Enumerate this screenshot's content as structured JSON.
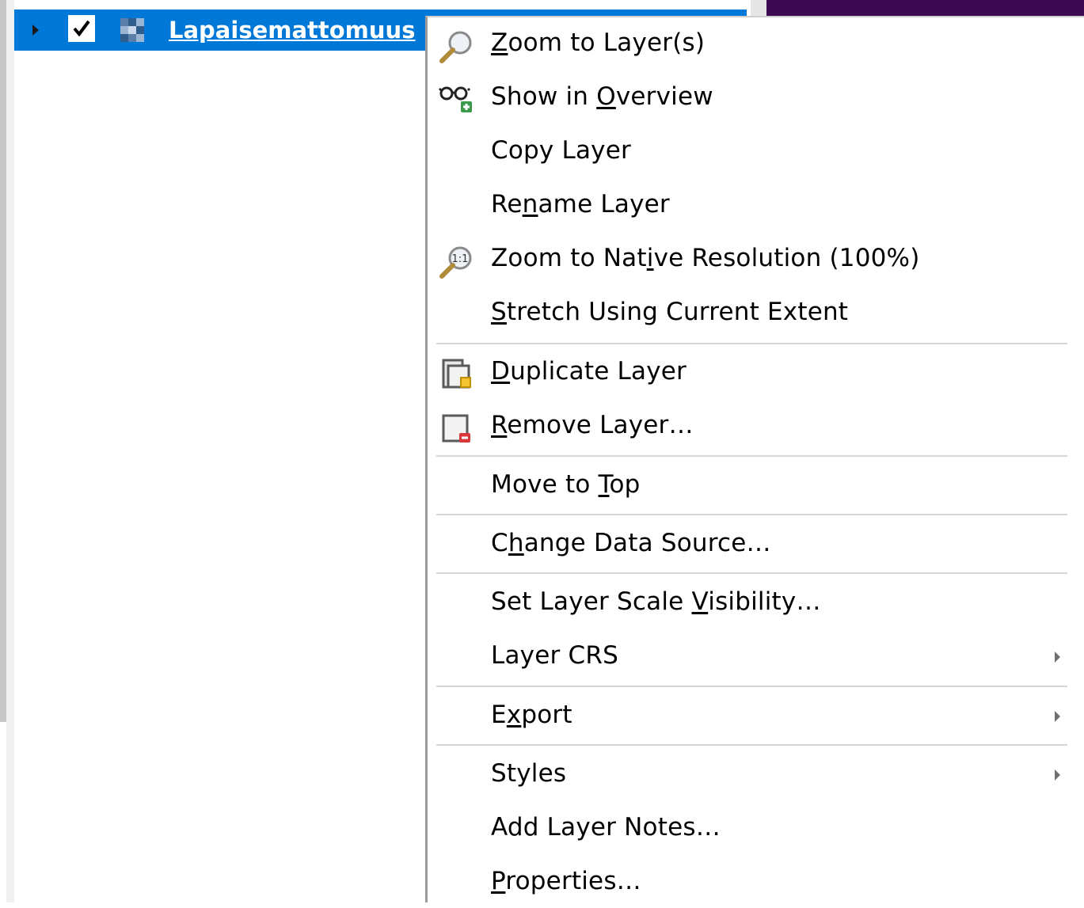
{
  "layer_panel": {
    "layer_name": "Lapaisemattomuus",
    "checkbox_checked": true,
    "selected": true
  },
  "context_menu": {
    "items": [
      {
        "id": "zoom-to-layers",
        "pre": "",
        "key": "Z",
        "post": "oom to Layer(s)",
        "icon": "zoom-layer-icon"
      },
      {
        "id": "show-in-overview",
        "pre": "Show in ",
        "key": "O",
        "post": "verview",
        "icon": "overview-glasses-icon"
      },
      {
        "id": "copy-layer",
        "pre": "Copy Layer",
        "key": "",
        "post": "",
        "icon": ""
      },
      {
        "id": "rename-layer",
        "pre": "Re",
        "key": "n",
        "post": "ame Layer",
        "icon": ""
      },
      {
        "id": "zoom-native",
        "pre": "Zoom to Nat",
        "key": "i",
        "post": "ve Resolution (100%)",
        "icon": "zoom-native-icon"
      },
      {
        "id": "stretch-extent",
        "pre": "",
        "key": "S",
        "post": "tretch Using Current Extent",
        "icon": ""
      },
      {
        "id": "duplicate-layer",
        "pre": "",
        "key": "D",
        "post": "uplicate Layer",
        "icon": "duplicate-layer-icon"
      },
      {
        "id": "remove-layer",
        "pre": "",
        "key": "R",
        "post": "emove Layer…",
        "icon": "remove-layer-icon"
      },
      {
        "id": "move-to-top",
        "pre": "Move to ",
        "key": "T",
        "post": "op",
        "icon": ""
      },
      {
        "id": "change-data-source",
        "pre": "C",
        "key": "h",
        "post": "ange Data Source…",
        "icon": ""
      },
      {
        "id": "scale-visibility",
        "pre": "Set Layer Scale ",
        "key": "V",
        "post": "isibility…",
        "icon": ""
      },
      {
        "id": "layer-crs",
        "pre": "Layer CRS",
        "key": "",
        "post": "",
        "icon": "",
        "submenu": true
      },
      {
        "id": "export",
        "pre": "E",
        "key": "x",
        "post": "port",
        "icon": "",
        "submenu": true
      },
      {
        "id": "styles",
        "pre": "Styles",
        "key": "",
        "post": "",
        "icon": "",
        "submenu": true
      },
      {
        "id": "add-layer-notes",
        "pre": "Add Layer Notes…",
        "key": "",
        "post": "",
        "icon": ""
      },
      {
        "id": "properties",
        "pre": "",
        "key": "P",
        "post": "roperties…",
        "icon": ""
      }
    ]
  },
  "colors": {
    "selection": "#0078d7",
    "map_background": "#3b0a52",
    "separator": "#d7d7d7"
  }
}
